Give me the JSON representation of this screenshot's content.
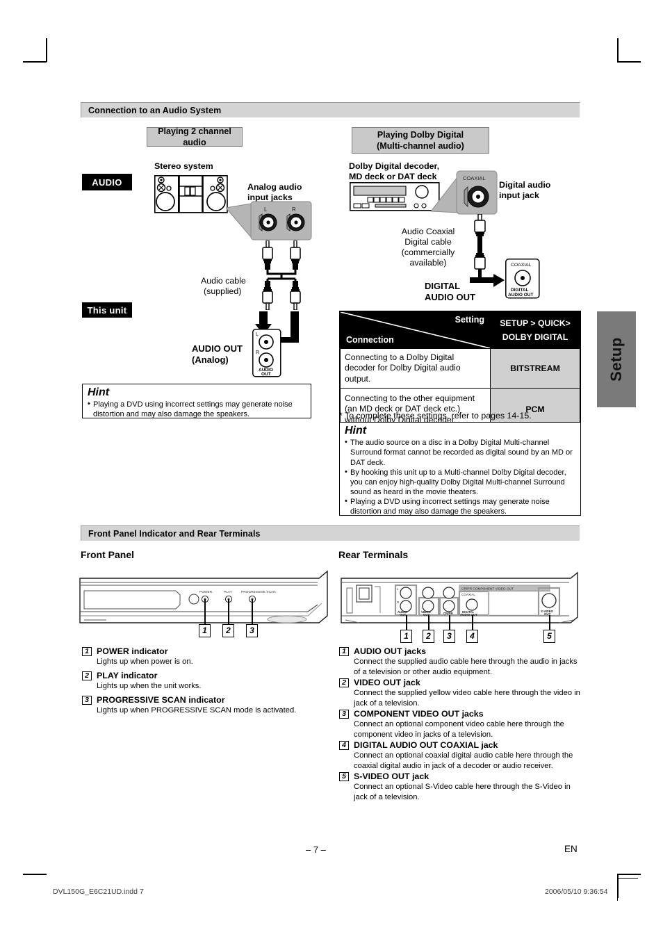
{
  "sections": {
    "audio_system": "Connection to an Audio System",
    "front_rear": "Front Panel Indicator and Rear Terminals"
  },
  "left_diagram": {
    "caption": "Playing 2 channel audio",
    "badge_audio": "AUDIO",
    "badge_this_unit": "This unit",
    "stereo_system_label": "Stereo system",
    "analog_jacks_label": "Analog audio\ninput jacks",
    "analog_jacks_label_l1": "Analog audio",
    "analog_jacks_label_l2": "input jacks",
    "jack_l": "L",
    "jack_r": "R",
    "audio_cable_l1": "Audio cable",
    "audio_cable_l2": "(supplied)",
    "audio_out_l1": "AUDIO OUT",
    "audio_out_l2": "(Analog)",
    "unit_jack_label_1": "AUDIO",
    "unit_jack_label_2": "OUT"
  },
  "right_diagram": {
    "caption_l1": "Playing Dolby Digital",
    "caption_l2": "(Multi-channel audio)",
    "decoder_l1": "Dolby Digital decoder,",
    "decoder_l2": "MD deck or DAT deck",
    "coaxial_label": "COAXIAL",
    "digital_jack_l1": "Digital audio",
    "digital_jack_l2": "input jack",
    "cable_l1": "Audio Coaxial",
    "cable_l2": "Digital cable",
    "cable_l3": "(commercially",
    "cable_l4": "available)",
    "digital_out_l1": "DIGITAL",
    "digital_out_l2": "AUDIO OUT",
    "unit_jack_top": "COAXIAL",
    "unit_jack_b1": "DIGITAL",
    "unit_jack_b2": "AUDIO OUT"
  },
  "setting_table": {
    "header_setting": "Setting",
    "header_connection": "Connection",
    "header_right_l1": "SETUP > QUICK>",
    "header_right_l2": "DOLBY DIGITAL",
    "rows": [
      {
        "connection": "Connecting to a Dolby Digital decoder for Dolby Digital audio output.",
        "value": "BITSTREAM"
      },
      {
        "connection": "Connecting to the other equipment (an MD deck or DAT deck etc.) without Dolby Digital decoder.",
        "value": "PCM"
      }
    ],
    "note": "* To complete these settings, refer to pages 14-15."
  },
  "hint_left": {
    "title": "Hint",
    "items": [
      "Playing a DVD using incorrect settings may generate noise distortion and may also damage the speakers."
    ]
  },
  "hint_right": {
    "title": "Hint",
    "items": [
      "The audio source on a disc in a Dolby Digital Multi-channel Surround format cannot be recorded as digital sound by an MD or DAT deck.",
      "By hooking this unit up to a Multi-channel Dolby Digital decoder, you can enjoy high-quality Dolby Digital Multi-channel Surround sound as heard in the movie theaters.",
      "Playing a DVD using incorrect settings may generate noise distortion and may also damage the speakers."
    ]
  },
  "front_panel": {
    "title": "Front Panel",
    "device_labels": {
      "power": "POWER",
      "play": "PLAY",
      "progressive": "PROGRESSIVE SCAN"
    },
    "callouts": [
      "1",
      "2",
      "3"
    ],
    "items": [
      {
        "num": "1",
        "title": "POWER indicator",
        "desc": "Lights up when power is on."
      },
      {
        "num": "2",
        "title": "PLAY indicator",
        "desc": "Lights up when the unit works."
      },
      {
        "num": "3",
        "title": "PROGRESSIVE SCAN indicator",
        "desc": "Lights up when PROGRESSIVE SCAN mode is activated."
      }
    ]
  },
  "rear_terminals": {
    "title": "Rear Terminals",
    "device_labels": {
      "component": "CR/PR   COMPONENT VIDEO OUT",
      "coaxial": "COAXIAL",
      "audio_out_1": "AUDIO",
      "audio_out_2": "OUT",
      "video_out_1": "VIDEO",
      "video_out_2": "OUT",
      "crpr": "CR/PR",
      "digital_1": "DIGITAL",
      "digital_2": "AUDIO OUT",
      "svideo_1": "S-VIDEO",
      "svideo_2": "OUT",
      "jack_l": "L",
      "jack_r": "R",
      "jack_y": "Y"
    },
    "callouts": [
      "1",
      "2",
      "3",
      "4",
      "5"
    ],
    "items": [
      {
        "num": "1",
        "title": "AUDIO OUT jacks",
        "desc": "Connect the supplied audio cable here through the audio in jacks of a television or other audio equipment."
      },
      {
        "num": "2",
        "title": "VIDEO OUT jack",
        "desc": "Connect the supplied yellow video cable here through the video in jack of a television."
      },
      {
        "num": "3",
        "title": "COMPONENT VIDEO OUT jacks",
        "desc": "Connect an optional component video cable here through the component video in jacks of a television."
      },
      {
        "num": "4",
        "title": "DIGITAL AUDIO OUT COAXIAL jack",
        "desc": "Connect an optional coaxial digital audio cable here through the coaxial digital audio in jack of a decoder or audio receiver."
      },
      {
        "num": "5",
        "title": "S-VIDEO OUT jack",
        "desc": "Connect an optional S-Video cable here through the S-Video in jack of a television."
      }
    ]
  },
  "side_tab": {
    "label": "Setup"
  },
  "footer": {
    "page_number": "– 7 –",
    "language": "EN",
    "file_name": "DVL150G_E6C21UD.indd   7",
    "timestamp": "2006/05/10   9:36:54"
  }
}
